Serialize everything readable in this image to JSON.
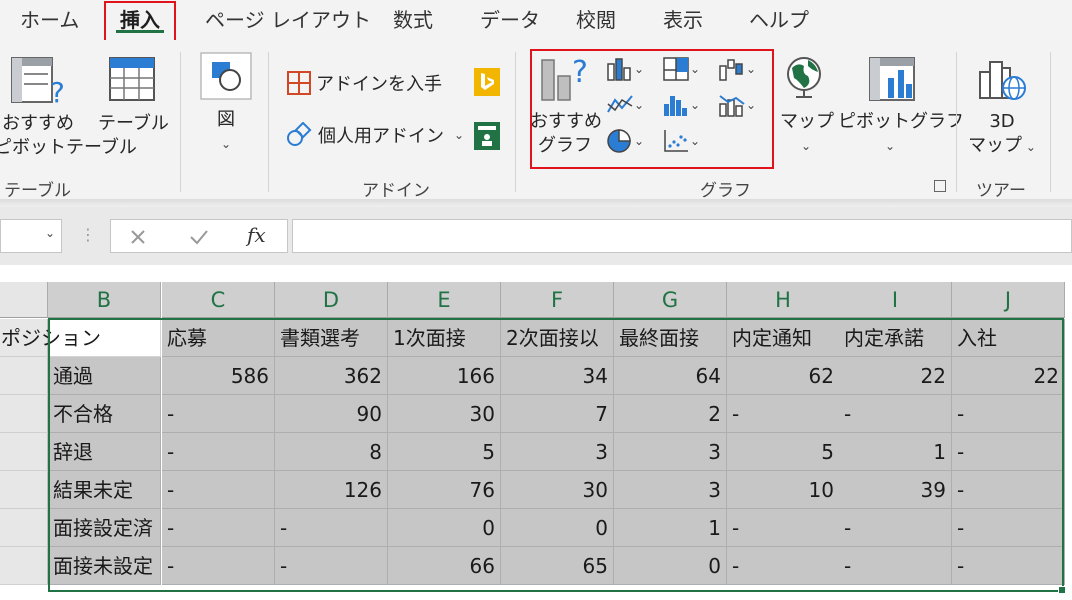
{
  "tabs": [
    {
      "label": "ホーム",
      "active": false
    },
    {
      "label": "挿入",
      "active": true
    },
    {
      "label": "ページ レイアウト",
      "active": false
    },
    {
      "label": "数式",
      "active": false
    },
    {
      "label": "データ",
      "active": false
    },
    {
      "label": "校閲",
      "active": false
    },
    {
      "label": "表示",
      "active": false
    },
    {
      "label": "ヘルプ",
      "active": false
    }
  ],
  "ribbon": {
    "table_group": {
      "recommended_pivot_line1": "おすすめ",
      "recommended_pivot_line2": "ピボットテーブル",
      "table_label": "テーブル",
      "group_label": "テーブル"
    },
    "illustration": {
      "label": "図"
    },
    "addins": {
      "get_addins": "アドインを入手",
      "my_addins": "個人用アドイン",
      "group_label": "アドイン"
    },
    "charts": {
      "recommended_line1": "おすすめ",
      "recommended_line2": "グラフ",
      "group_label": "グラフ"
    },
    "maps_label": "マップ",
    "pivot_chart_label": "ピボットグラフ",
    "tours": {
      "line1": "3D",
      "line2": "マップ",
      "group_label": "ツアー"
    }
  },
  "formula_bar": {
    "fx_label": "fx",
    "value": ""
  },
  "columns": [
    "B",
    "C",
    "D",
    "E",
    "F",
    "G",
    "H",
    "I",
    "J"
  ],
  "table": {
    "header_row": [
      "ポジション",
      "応募",
      "書類選考",
      "1次面接",
      "2次面接以",
      "最終面接",
      "内定通知",
      "内定承諾",
      "入社"
    ],
    "rows": [
      [
        "通過",
        "586",
        "362",
        "166",
        "34",
        "64",
        "62",
        "22",
        "22"
      ],
      [
        "不合格",
        "-",
        "90",
        "30",
        "7",
        "2",
        "-",
        "-",
        "-"
      ],
      [
        "辞退",
        "-",
        "8",
        "5",
        "3",
        "3",
        "5",
        "1",
        "-"
      ],
      [
        "結果未定",
        "-",
        "126",
        "76",
        "30",
        "3",
        "10",
        "39",
        "-"
      ],
      [
        "面接設定済",
        "-",
        "-",
        "0",
        "0",
        "1",
        "-",
        "-",
        "-"
      ],
      [
        "面接未設定",
        "-",
        "-",
        "66",
        "65",
        "0",
        "-",
        "-",
        "-"
      ]
    ]
  },
  "colors": {
    "accent": "#217346",
    "highlight": "#e0121b",
    "selection": "#c6c6c6"
  }
}
